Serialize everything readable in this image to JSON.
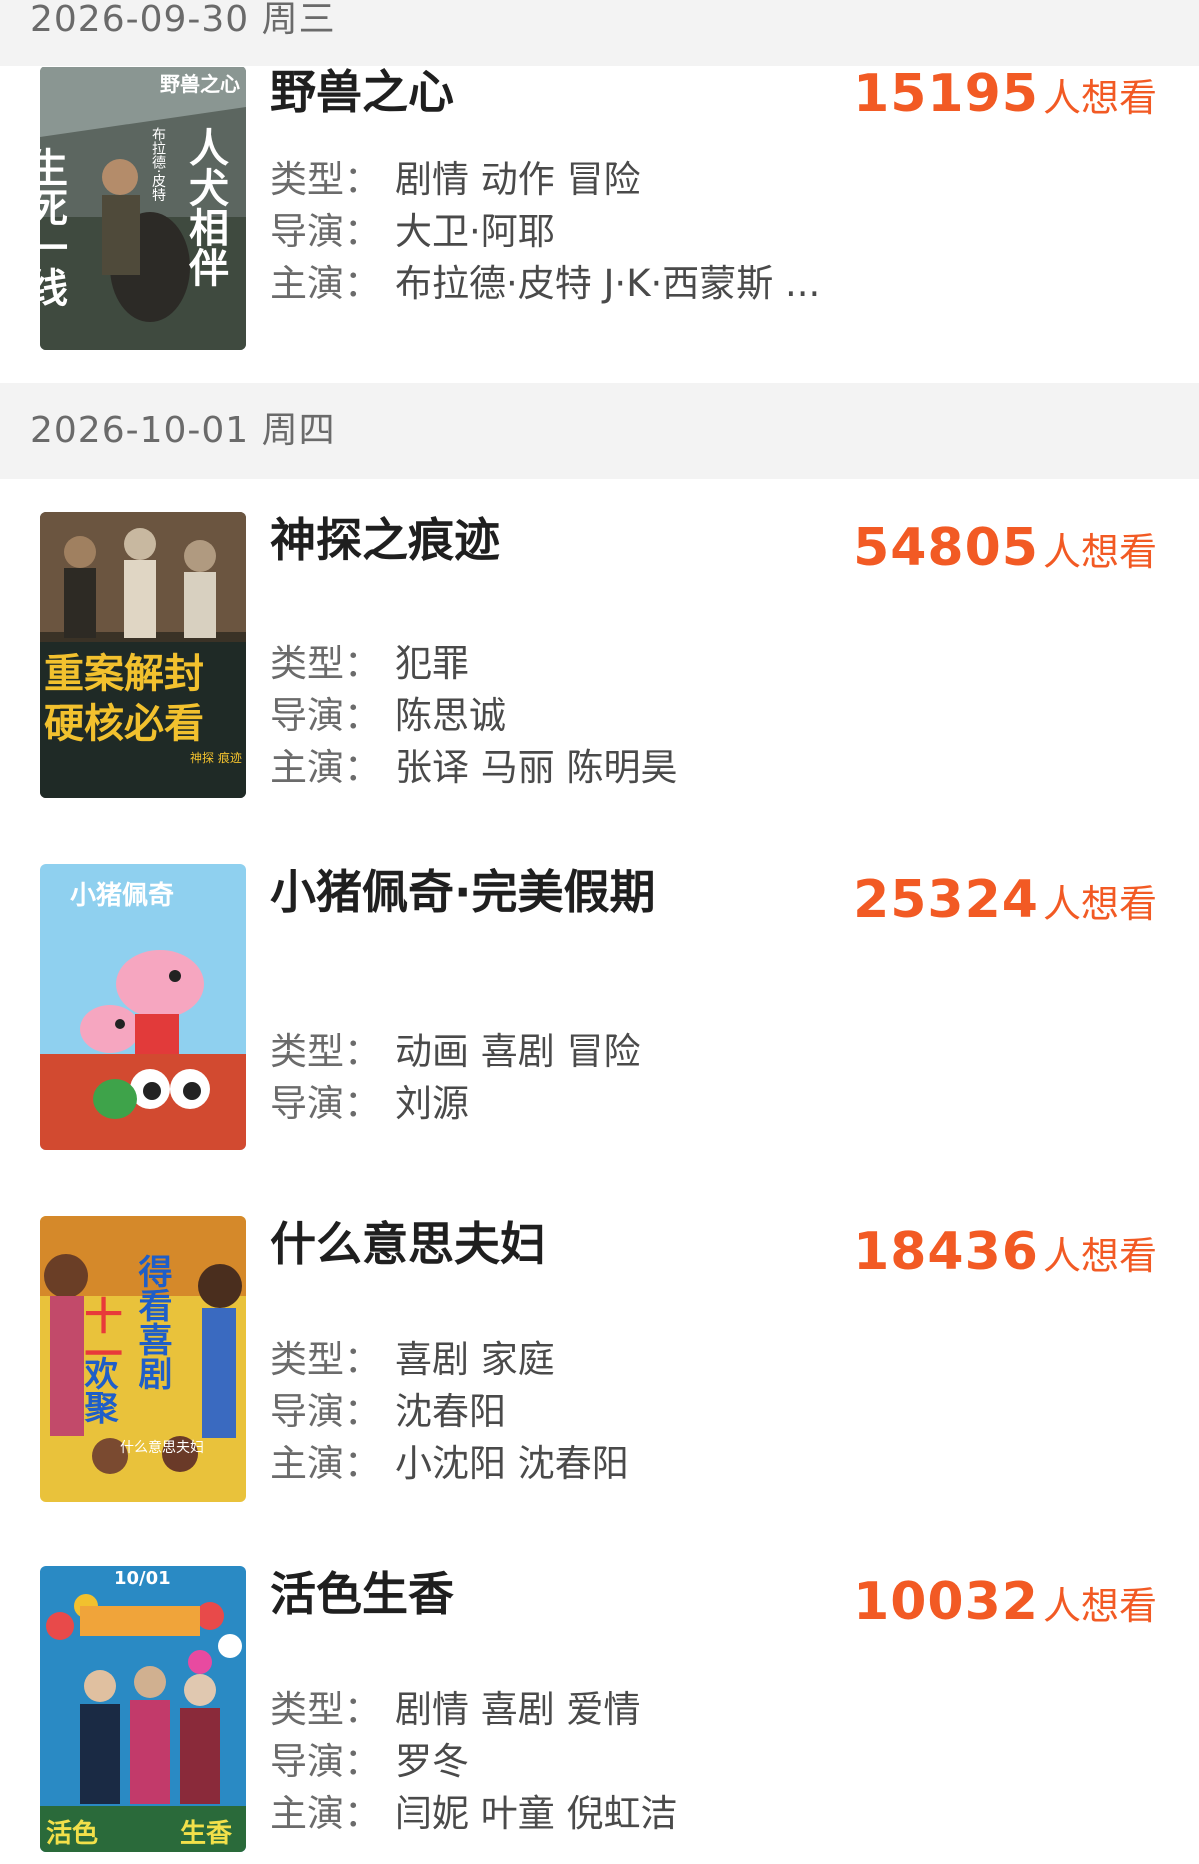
{
  "dates": [
    {
      "label": "2026-09-30 周三"
    },
    {
      "label": "2026-10-01 周四"
    }
  ],
  "labels": {
    "genre": "类型：",
    "director": "导演：",
    "cast": "主演：",
    "want_suffix": "人想看"
  },
  "movies": [
    {
      "title": "野兽之心",
      "want_count": "15195",
      "genre": "剧情 动作 冒险",
      "director": "大卫·阿耶",
      "cast": "布拉德·皮特 J·K·西蒙斯 ...",
      "poster_text": [
        "野兽之心",
        "生死一线",
        "人犬相伴",
        "布拉德·皮特"
      ]
    },
    {
      "title": "神探之痕迹",
      "want_count": "54805",
      "genre": "犯罪",
      "director": "陈思诚",
      "cast": "张译 马丽 陈明昊",
      "poster_text": [
        "重案解封",
        "硬核必看",
        "神探 痕迹"
      ]
    },
    {
      "title": "小猪佩奇·完美假期",
      "want_count": "25324",
      "genre": "动画 喜剧 冒险",
      "director": "刘源",
      "poster_text": [
        "小猪佩奇"
      ]
    },
    {
      "title": "什么意思夫妇",
      "want_count": "18436",
      "genre": "喜剧 家庭",
      "director": "沈春阳",
      "cast": "小沈阳 沈春阳",
      "poster_text": [
        "十一",
        "欢聚",
        "得看喜剧",
        "什么意思夫妇"
      ]
    },
    {
      "title": "活色生香",
      "want_count": "10032",
      "genre": "剧情 喜剧 爱情",
      "director": "罗冬",
      "cast": "闫妮 叶童 倪虹洁",
      "poster_text": [
        "10/01",
        "活色",
        "生香"
      ]
    }
  ]
}
